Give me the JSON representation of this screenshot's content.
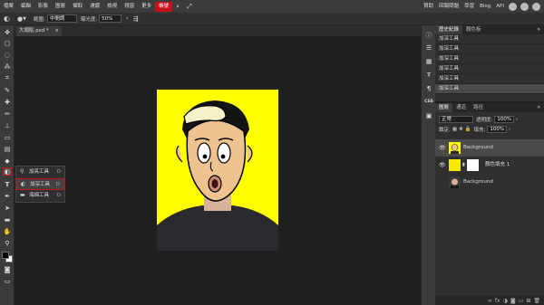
{
  "menu": {
    "items": [
      "檔案",
      "編輯",
      "影像",
      "圖層",
      "擷取",
      "濾鏡",
      "檢視",
      "視窗",
      "更多"
    ],
    "active": "帳號",
    "right": [
      "贊助",
      "回報問題",
      "學習",
      "Blog",
      "API"
    ]
  },
  "options": {
    "range_label": "範圍:",
    "range_value": "中間調",
    "exposure_label": "曝光度:",
    "exposure_value": "50%"
  },
  "document": {
    "tab_title": "大頭貼.psd *",
    "close": "×"
  },
  "flyout": {
    "items": [
      {
        "label": "加亮工具",
        "key": "O",
        "icon": "dodge-icon"
      },
      {
        "label": "加深工具",
        "key": "O",
        "icon": "burn-icon"
      },
      {
        "label": "海綿工具",
        "key": "O",
        "icon": "sponge-icon"
      }
    ],
    "selected": 1
  },
  "history": {
    "tabs": [
      "歷史紀錄",
      "顏色板"
    ],
    "items": [
      "加深工具",
      "加深工具",
      "加深工具",
      "加深工具",
      "加深工具",
      "加深工具"
    ],
    "selected": 5
  },
  "layers": {
    "tabs": [
      "圖層",
      "通道",
      "路徑"
    ],
    "blend_mode": "正常",
    "opacity_label": "透明度:",
    "opacity_value": "100%",
    "lock_label": "鎖定:",
    "fill_label": "填充:",
    "fill_value": "100%",
    "items": [
      {
        "name": "Background"
      },
      {
        "name": "顏色填充 1"
      },
      {
        "name": "Background"
      }
    ]
  },
  "colors": {
    "accent": "#c8101a",
    "canvas_bg": "#ffff00",
    "fill_swatch": "#f5ea00"
  }
}
